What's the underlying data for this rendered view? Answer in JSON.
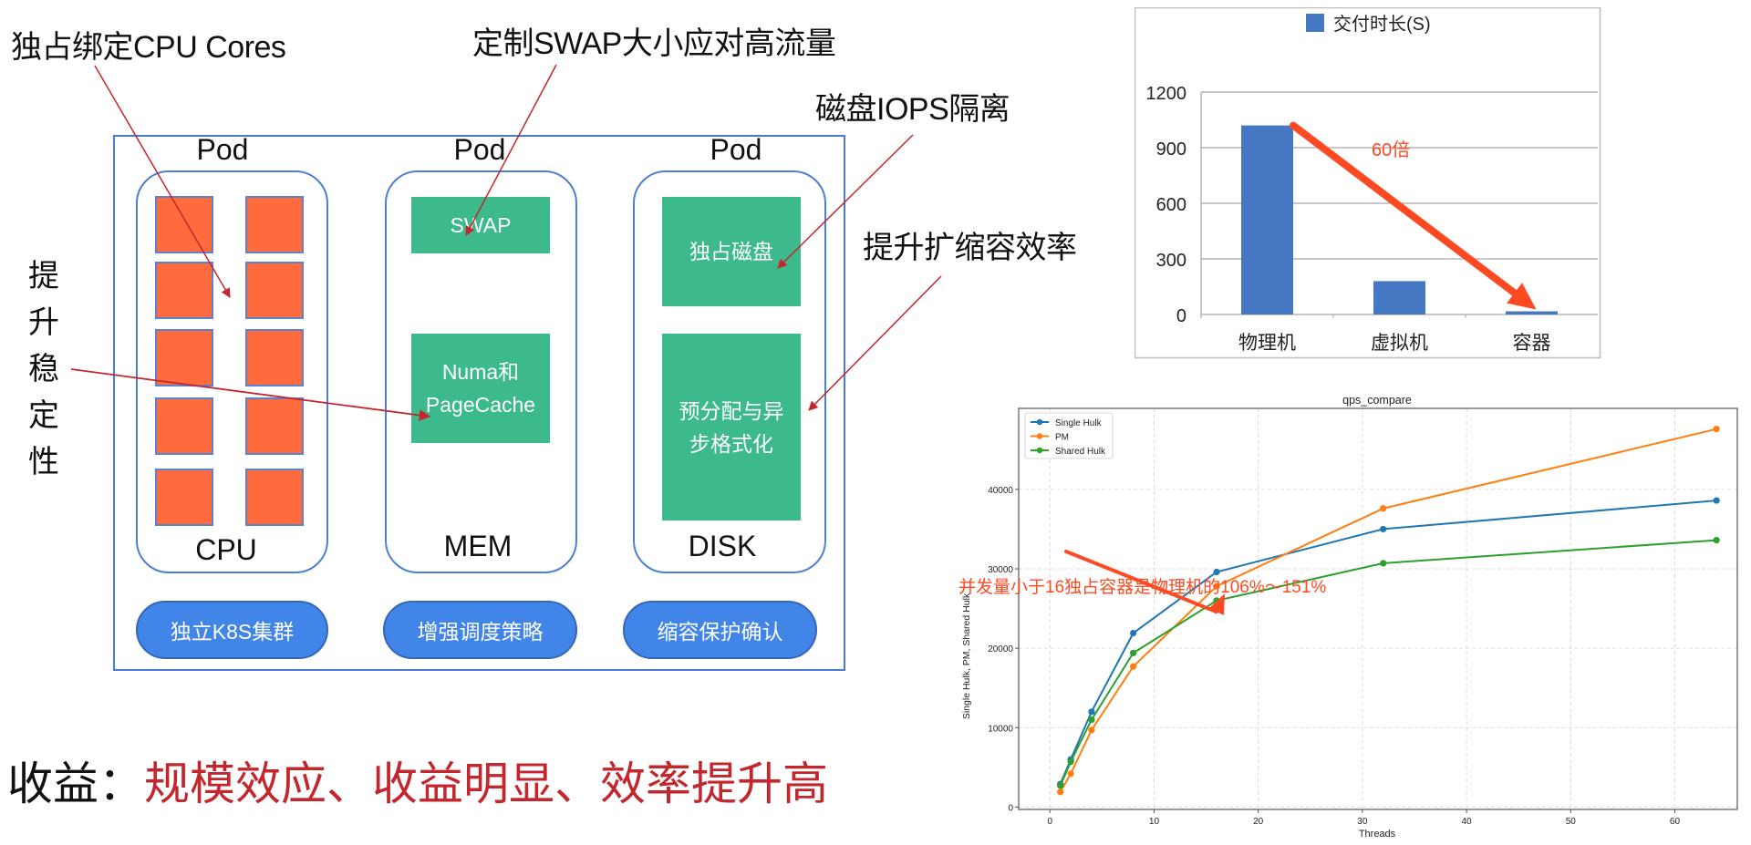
{
  "callouts": {
    "cpu_cores": "独占绑定CPU Cores",
    "swap": "定制SWAP大小应对高流量",
    "disk_iops": "磁盘IOPS隔离",
    "scale_efficiency": "提升扩缩容效率",
    "stability_chars": [
      "提",
      "升",
      "稳",
      "定",
      "性"
    ]
  },
  "diagram": {
    "pods": [
      {
        "title": "Pod",
        "resource": "CPU",
        "cores": 10
      },
      {
        "title": "Pod",
        "resource": "MEM",
        "blocks": [
          "SWAP",
          "Numa和\nPageCache"
        ]
      },
      {
        "title": "Pod",
        "resource": "DISK",
        "blocks": [
          "独占磁盘",
          "预分配与异\n步格式化"
        ]
      }
    ],
    "pills": [
      "独立K8S集群",
      "增强调度策略",
      "缩容保护确认"
    ],
    "colors": {
      "core": "#ff6b3d",
      "green_block": "#3dba8b",
      "pill": "#4285e8",
      "frame": "#4a7bd0",
      "annotation_arrow": "#c4262d"
    }
  },
  "benefit": {
    "label": "收益：",
    "value": "规模效应、收益明显、效率提升高"
  },
  "chart_data": [
    {
      "type": "bar",
      "title": "",
      "legend": [
        "交付时长(S)"
      ],
      "legend_position": "top-center",
      "categories": [
        "物理机",
        "虚拟机",
        "容器"
      ],
      "values": [
        1020,
        180,
        17
      ],
      "ylim": [
        0,
        1200
      ],
      "yticks": [
        0,
        300,
        600,
        900,
        1200
      ],
      "grid": true,
      "color": "#4677c2",
      "annotation": {
        "text": "60倍",
        "from": "物理机",
        "to": "容器",
        "color": "#fe4a22"
      }
    },
    {
      "type": "line",
      "title": "qps_compare",
      "xlabel": "Threads",
      "ylabel": "Single Hulk, PM, Shared Hulk",
      "x": [
        1,
        2,
        4,
        8,
        16,
        32,
        64
      ],
      "xlim": [
        -3,
        66
      ],
      "ylim": [
        -300,
        50200
      ],
      "xticks": [
        0,
        10,
        20,
        30,
        40,
        50,
        60
      ],
      "yticks": [
        0,
        10000,
        20000,
        30000,
        40000
      ],
      "grid": true,
      "legend_position": "top-left",
      "series": [
        {
          "name": "Single Hulk",
          "color": "#1f77b4",
          "values": [
            2900,
            6000,
            12000,
            21900,
            29600,
            35000,
            38600
          ]
        },
        {
          "name": "PM",
          "color": "#ff7f0e",
          "values": [
            1900,
            4200,
            9700,
            17700,
            27800,
            37600,
            47600
          ]
        },
        {
          "name": "Shared Hulk",
          "color": "#2ca02c",
          "values": [
            2700,
            5700,
            11000,
            19400,
            26000,
            30700,
            33600
          ]
        }
      ],
      "annotation": {
        "text": "并发量小于16独占容器是物理机的106%～151%",
        "color": "#fe4a22",
        "points_to_x": 16
      }
    }
  ]
}
